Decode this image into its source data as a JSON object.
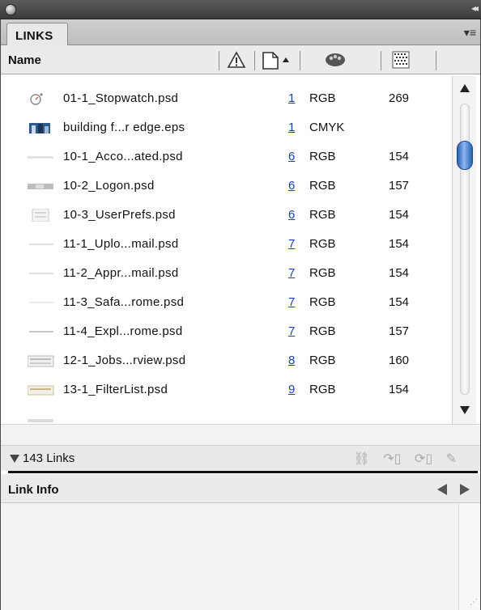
{
  "panel": {
    "tab_label": "LINKS"
  },
  "columns": {
    "name": "Name"
  },
  "links": [
    {
      "name": "01-1_Stopwatch.psd",
      "page": "1",
      "color": "RGB",
      "ppi": "269",
      "thumb": "stopwatch-thumbnail"
    },
    {
      "name": "building f...r edge.eps",
      "page": "1",
      "color": "CMYK",
      "ppi": "",
      "thumb": "building-thumbnail"
    },
    {
      "name": "10-1_Acco...ated.psd",
      "page": "6",
      "color": "RGB",
      "ppi": "154",
      "thumb": "screenshot-thumbnail"
    },
    {
      "name": "10-2_Logon.psd",
      "page": "6",
      "color": "RGB",
      "ppi": "157",
      "thumb": "screenshot-thumbnail"
    },
    {
      "name": "10-3_UserPrefs.psd",
      "page": "6",
      "color": "RGB",
      "ppi": "154",
      "thumb": "screenshot-thumbnail"
    },
    {
      "name": "11-1_Uplo...mail.psd",
      "page": "7",
      "color": "RGB",
      "ppi": "154",
      "thumb": "screenshot-thumbnail"
    },
    {
      "name": "11-2_Appr...mail.psd",
      "page": "7",
      "color": "RGB",
      "ppi": "154",
      "thumb": "screenshot-thumbnail"
    },
    {
      "name": "11-3_Safa...rome.psd",
      "page": "7",
      "color": "RGB",
      "ppi": "154",
      "thumb": "screenshot-thumbnail"
    },
    {
      "name": "11-4_Expl...rome.psd",
      "page": "7",
      "color": "RGB",
      "ppi": "157",
      "thumb": "screenshot-thumbnail"
    },
    {
      "name": "12-1_Jobs...rview.psd",
      "page": "8",
      "color": "RGB",
      "ppi": "160",
      "thumb": "screenshot-thumbnail"
    },
    {
      "name": "13-1_FilterList.psd",
      "page": "9",
      "color": "RGB",
      "ppi": "154",
      "thumb": "screenshot-thumbnail"
    }
  ],
  "status": {
    "count": "143 Links"
  },
  "link_info": {
    "title": "Link Info"
  },
  "colors": {
    "page_link": "#1a3fb8",
    "scroll_thumb": "#2a5fb0"
  }
}
